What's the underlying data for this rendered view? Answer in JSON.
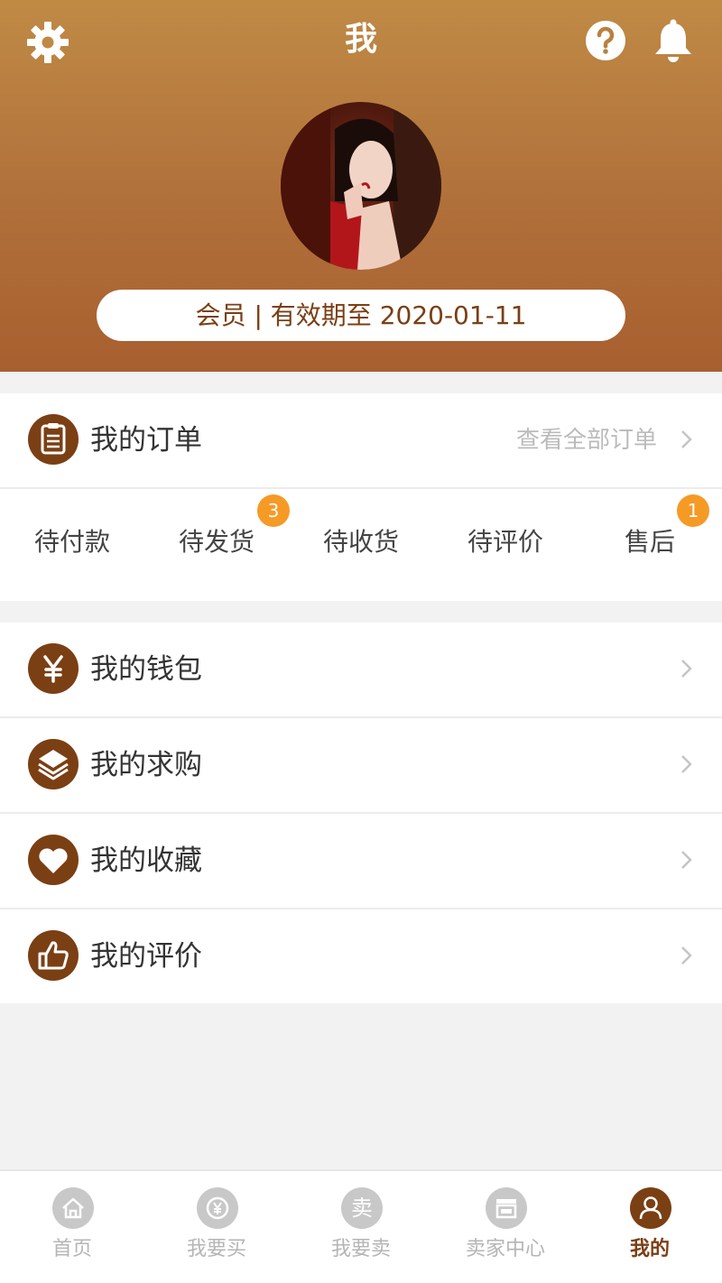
{
  "header": {
    "title": "我",
    "member_status": "会员 | 有效期至 2020-01-11"
  },
  "icons": {
    "settings": "gear-icon",
    "help": "question-icon",
    "notifications": "bell-icon"
  },
  "orders": {
    "title": "我的订单",
    "view_all": "查看全部订单",
    "statuses": [
      {
        "label": "待付款",
        "badge": ""
      },
      {
        "label": "待发货",
        "badge": "3"
      },
      {
        "label": "待收货",
        "badge": ""
      },
      {
        "label": "待评价",
        "badge": ""
      },
      {
        "label": "售后",
        "badge": "1"
      }
    ]
  },
  "menu": [
    {
      "label": "我的钱包",
      "icon": "yen-icon"
    },
    {
      "label": "我的求购",
      "icon": "layers-icon"
    },
    {
      "label": "我的收藏",
      "icon": "heart-icon"
    },
    {
      "label": "我的评价",
      "icon": "thumbs-up-icon"
    }
  ],
  "bottom_nav": [
    {
      "label": "首页",
      "icon": "home-icon",
      "active": false
    },
    {
      "label": "我要买",
      "icon": "yen-circle-icon",
      "active": false
    },
    {
      "label": "我要卖",
      "icon": "sell-icon",
      "icon_text": "卖",
      "active": false
    },
    {
      "label": "卖家中心",
      "icon": "shop-icon",
      "active": false
    },
    {
      "label": "我的",
      "icon": "user-icon",
      "active": true
    }
  ],
  "colors": {
    "brand": "#7b3f14",
    "header_top": "#c08a45",
    "header_bottom": "#a85f2f",
    "badge": "#f59a25"
  }
}
